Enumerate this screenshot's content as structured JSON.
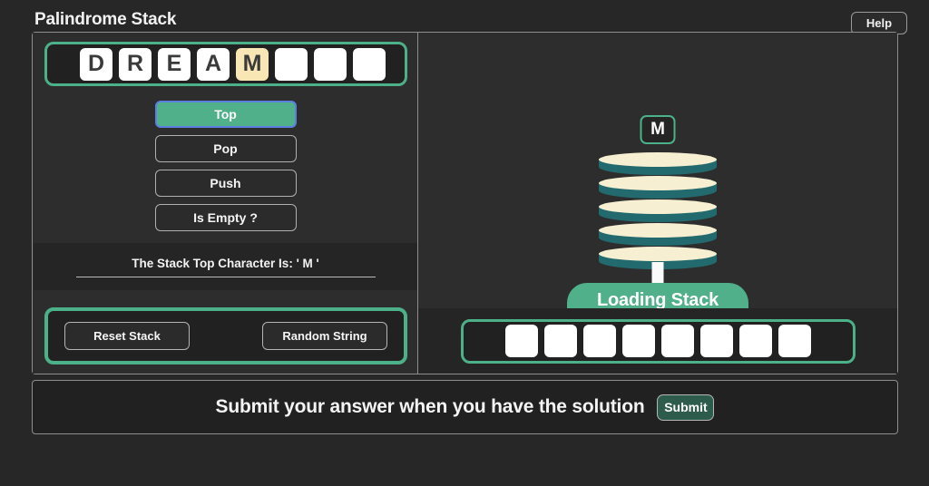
{
  "app": {
    "title": "Palindrome Stack",
    "help_label": "Help"
  },
  "input_word": {
    "tiles": [
      {
        "letter": "D",
        "highlighted": false
      },
      {
        "letter": "R",
        "highlighted": false
      },
      {
        "letter": "E",
        "highlighted": false
      },
      {
        "letter": "A",
        "highlighted": false
      },
      {
        "letter": "M",
        "highlighted": true
      },
      {
        "letter": "",
        "highlighted": false
      },
      {
        "letter": "",
        "highlighted": false
      },
      {
        "letter": "",
        "highlighted": false
      }
    ]
  },
  "operations": [
    {
      "label": "Top",
      "active": true
    },
    {
      "label": "Pop",
      "active": false
    },
    {
      "label": "Push",
      "active": false
    },
    {
      "label": "Is Empty ?",
      "active": false
    }
  ],
  "status": {
    "text": "The Stack Top Character Is: ' M '"
  },
  "controls": {
    "reset_label": "Reset Stack",
    "random_label": "Random String"
  },
  "stack_view": {
    "top_character": "M",
    "disk_count": 5,
    "base_label": "Loading Stack"
  },
  "output_word": {
    "tiles": [
      {
        "letter": "",
        "highlighted": false
      },
      {
        "letter": "",
        "highlighted": false
      },
      {
        "letter": "",
        "highlighted": false
      },
      {
        "letter": "",
        "highlighted": false
      },
      {
        "letter": "",
        "highlighted": false
      },
      {
        "letter": "",
        "highlighted": false
      },
      {
        "letter": "",
        "highlighted": false
      },
      {
        "letter": "",
        "highlighted": false
      }
    ]
  },
  "submit_bar": {
    "prompt": "Submit your answer when you have the solution",
    "button_label": "Submit"
  },
  "colors": {
    "accent_green": "#4cb088",
    "disk_top": "#f6efd2",
    "disk_side": "#226a6e",
    "tile_highlight": "#f8e7b5",
    "focus_blue": "#5a7fe0"
  }
}
